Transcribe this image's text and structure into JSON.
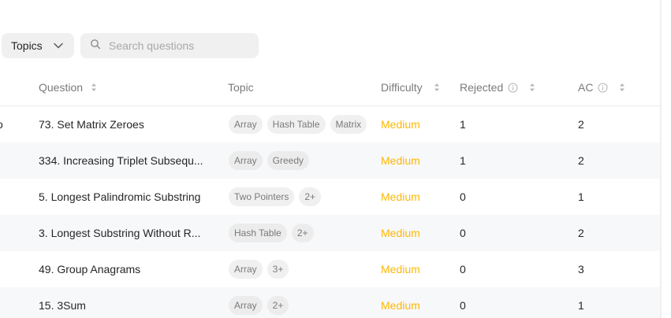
{
  "filters": {
    "topics_label": "Topics",
    "search_placeholder": "Search questions"
  },
  "table": {
    "headers": {
      "question": "Question",
      "topic": "Topic",
      "difficulty": "Difficulty",
      "rejected": "Rejected",
      "ac": "AC"
    },
    "rows": [
      {
        "edge": "o",
        "question": "73. Set Matrix Zeroes",
        "tags": [
          "Array",
          "Hash Table",
          "Matrix"
        ],
        "difficulty": "Medium",
        "rejected": "1",
        "ac": "2"
      },
      {
        "edge": "",
        "question": "334. Increasing Triplet Subsequ...",
        "tags": [
          "Array",
          "Greedy"
        ],
        "difficulty": "Medium",
        "rejected": "1",
        "ac": "2"
      },
      {
        "edge": "",
        "question": "5. Longest Palindromic Substring",
        "tags": [
          "Two Pointers",
          "2+"
        ],
        "difficulty": "Medium",
        "rejected": "0",
        "ac": "1"
      },
      {
        "edge": "",
        "question": "3. Longest Substring Without R...",
        "tags": [
          "Hash Table",
          "2+"
        ],
        "difficulty": "Medium",
        "rejected": "0",
        "ac": "2"
      },
      {
        "edge": "",
        "question": "49. Group Anagrams",
        "tags": [
          "Array",
          "3+"
        ],
        "difficulty": "Medium",
        "rejected": "0",
        "ac": "3"
      },
      {
        "edge": "",
        "question": "15. 3Sum",
        "tags": [
          "Array",
          "2+"
        ],
        "difficulty": "Medium",
        "rejected": "0",
        "ac": "1"
      }
    ]
  },
  "colors": {
    "medium": "#ffb800",
    "muted_text": "#7a7a7a",
    "tag_bg": "#f0f0f0",
    "alt_row_bg": "#f7f8fa"
  },
  "icons": {
    "dropdown": "chevron-down-icon",
    "search": "search-icon",
    "sort": "sort-icon",
    "info": "info-icon"
  }
}
